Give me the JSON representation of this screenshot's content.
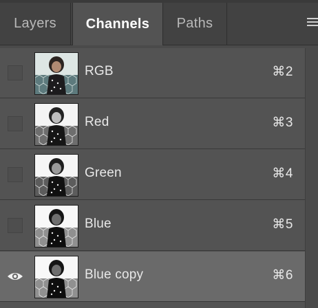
{
  "tabs": {
    "layers": "Layers",
    "channels": "Channels",
    "paths": "Paths",
    "active": "Channels"
  },
  "panel_menu_icon": "hamburger-icon",
  "channels": [
    {
      "name": "RGB",
      "shortcut": "⌘2",
      "visible": false,
      "selected": false,
      "thumb": "color"
    },
    {
      "name": "Red",
      "shortcut": "⌘3",
      "visible": false,
      "selected": false,
      "thumb": "light"
    },
    {
      "name": "Green",
      "shortcut": "⌘4",
      "visible": false,
      "selected": false,
      "thumb": "mid"
    },
    {
      "name": "Blue",
      "shortcut": "⌘5",
      "visible": false,
      "selected": false,
      "thumb": "dark"
    },
    {
      "name": "Blue copy",
      "shortcut": "⌘6",
      "visible": true,
      "selected": true,
      "thumb": "dark"
    }
  ],
  "colors": {
    "panel_bg": "#535353",
    "tabbar_bg": "#424242",
    "selected_row": "#6a6a6a",
    "text": "#e8e8e8"
  }
}
